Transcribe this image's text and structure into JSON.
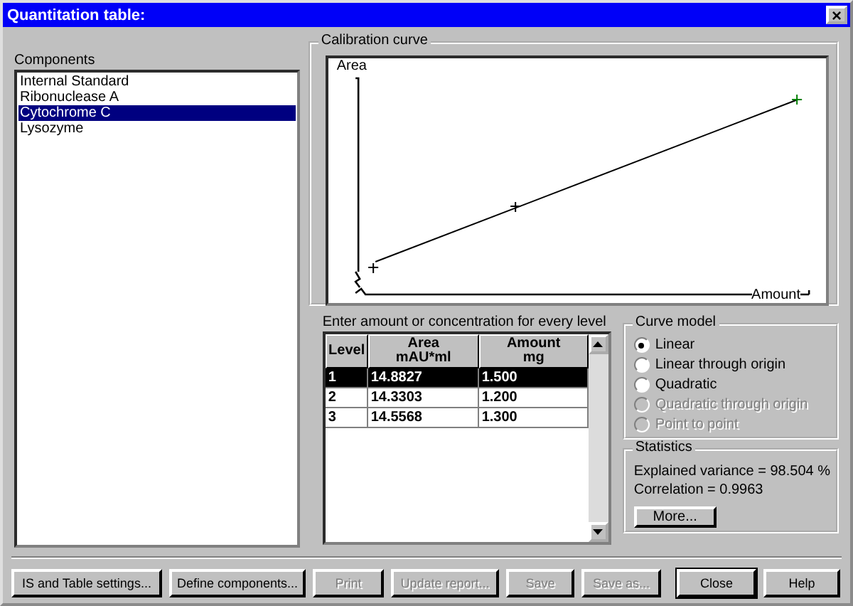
{
  "window": {
    "title": "Quantitation table:",
    "close": "×"
  },
  "components": {
    "label": "Components",
    "items": [
      {
        "name": "Internal Standard",
        "selected": false
      },
      {
        "name": "Ribonuclease A",
        "selected": false
      },
      {
        "name": "Cytochrome C",
        "selected": true
      },
      {
        "name": "Lysozyme",
        "selected": false
      }
    ]
  },
  "calibration": {
    "title": "Calibration curve",
    "y_label": "Area",
    "x_label": "Amount"
  },
  "levels": {
    "label": "Enter amount or concentration for every level",
    "columns": [
      {
        "title": "Level"
      },
      {
        "title": "Area",
        "unit": "mAU*ml"
      },
      {
        "title": "Amount",
        "unit": "mg"
      }
    ],
    "rows": [
      {
        "cells": [
          "1",
          "14.8827",
          "1.500"
        ],
        "selected": true
      },
      {
        "cells": [
          "2",
          "14.3303",
          "1.200"
        ],
        "selected": false
      },
      {
        "cells": [
          "3",
          "14.5568",
          "1.300"
        ],
        "selected": false
      }
    ]
  },
  "curve_model": {
    "title": "Curve model",
    "options": [
      {
        "label": "Linear",
        "selected": true,
        "disabled": false
      },
      {
        "label": "Linear through origin",
        "selected": false,
        "disabled": false
      },
      {
        "label": "Quadratic",
        "selected": false,
        "disabled": false
      },
      {
        "label": "Quadratic through origin",
        "selected": false,
        "disabled": true
      },
      {
        "label": "Point to point",
        "selected": false,
        "disabled": true
      }
    ]
  },
  "statistics": {
    "title": "Statistics",
    "lines": [
      "Explained variance = 98.504 %",
      "Correlation = 0.9963"
    ],
    "button": "More..."
  },
  "buttons": [
    {
      "label": "IS and Table settings...",
      "disabled": false,
      "default": false
    },
    {
      "label": "Define components...",
      "disabled": false,
      "default": false
    },
    {
      "label": "Print",
      "disabled": true,
      "default": false
    },
    {
      "label": "Update report...",
      "disabled": true,
      "default": false
    },
    {
      "label": "Save",
      "disabled": true,
      "default": false
    },
    {
      "label": "Save as...",
      "disabled": true,
      "default": false
    },
    {
      "label": "Close",
      "disabled": false,
      "default": true
    },
    {
      "label": "Help",
      "disabled": false,
      "default": false
    }
  ]
}
